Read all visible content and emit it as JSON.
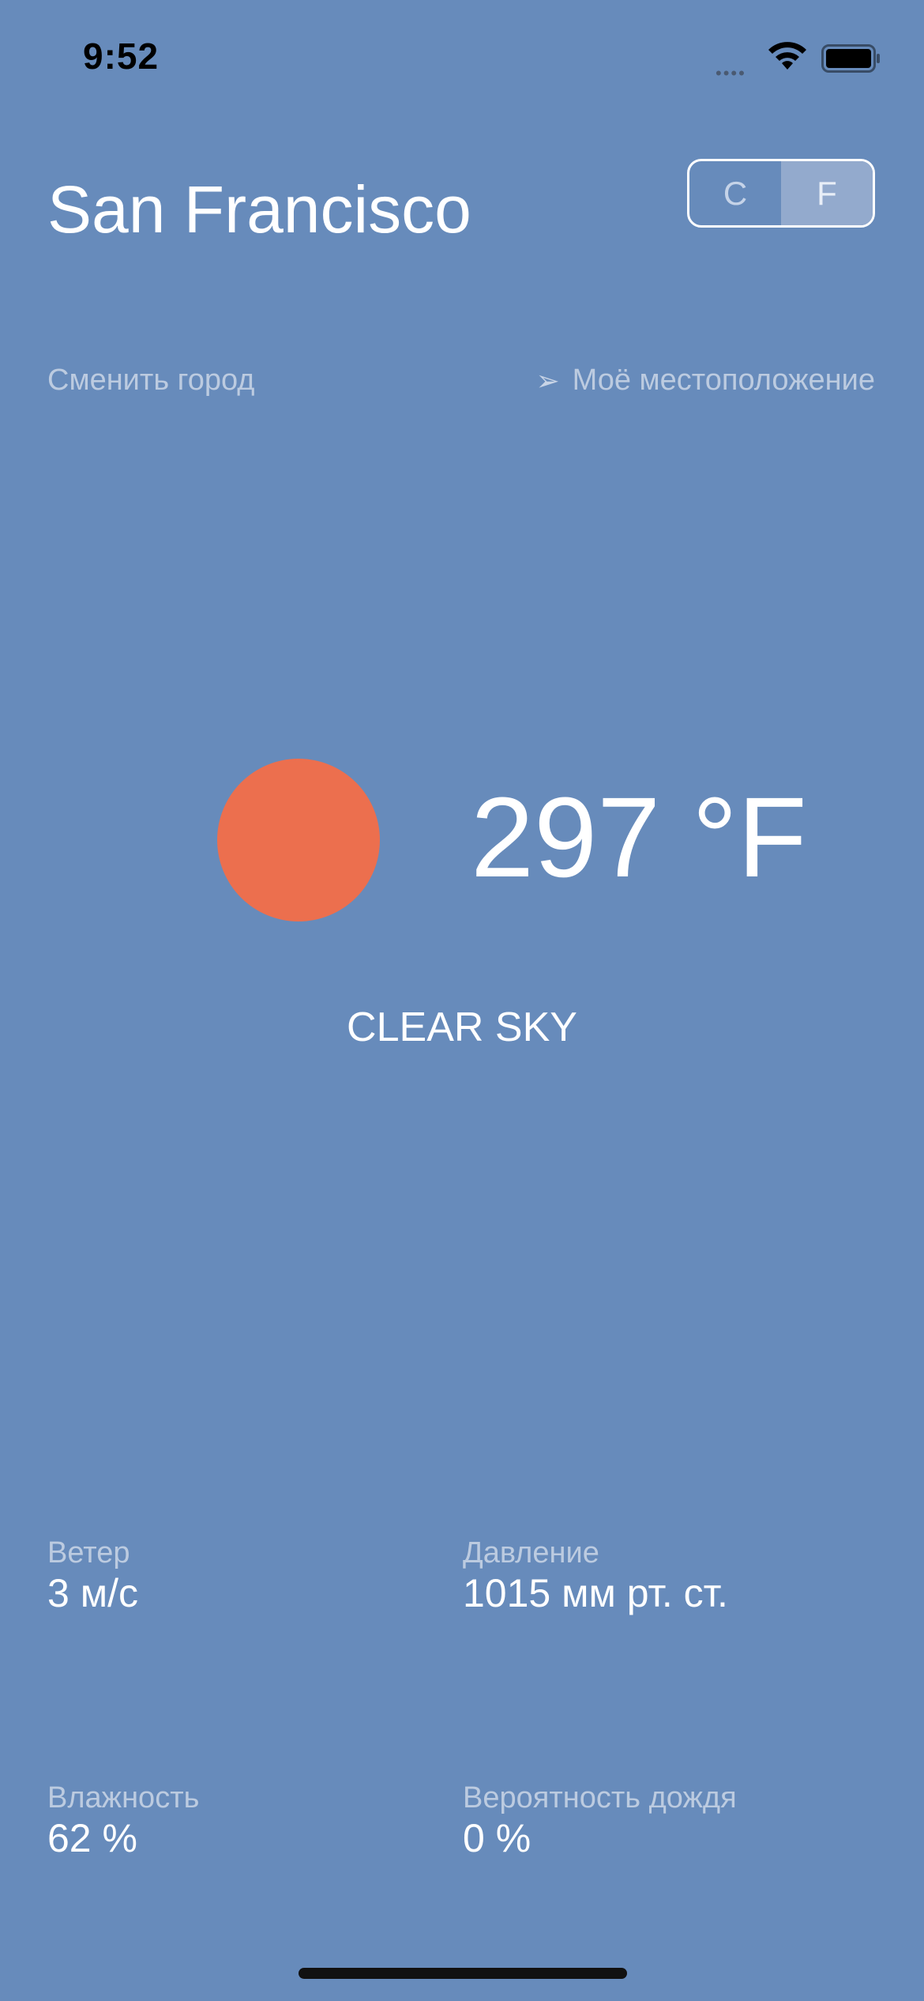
{
  "status_bar": {
    "time": "9:52",
    "signal_dots": "••••"
  },
  "header": {
    "city": "San Francisco",
    "units": {
      "celsius": "C",
      "fahrenheit": "F",
      "selected": "F"
    },
    "change_city": "Сменить город",
    "my_location": "Моё местоположение",
    "location_icon": "location-arrow-icon"
  },
  "current": {
    "icon": "sun-icon",
    "icon_color": "#EC6F4E",
    "temperature": "297 °F",
    "description": "CLEAR SKY"
  },
  "details": {
    "wind": {
      "label": "Ветер",
      "value": "3 м/с"
    },
    "pressure": {
      "label": "Давление",
      "value": "1015 мм рт. ст."
    },
    "humidity": {
      "label": "Влажность",
      "value": "62 %"
    },
    "rain_chance": {
      "label": "Вероятность дождя",
      "value": "0 %"
    }
  },
  "colors": {
    "background": "#678BBB",
    "toggle_active": "#93AACD"
  }
}
